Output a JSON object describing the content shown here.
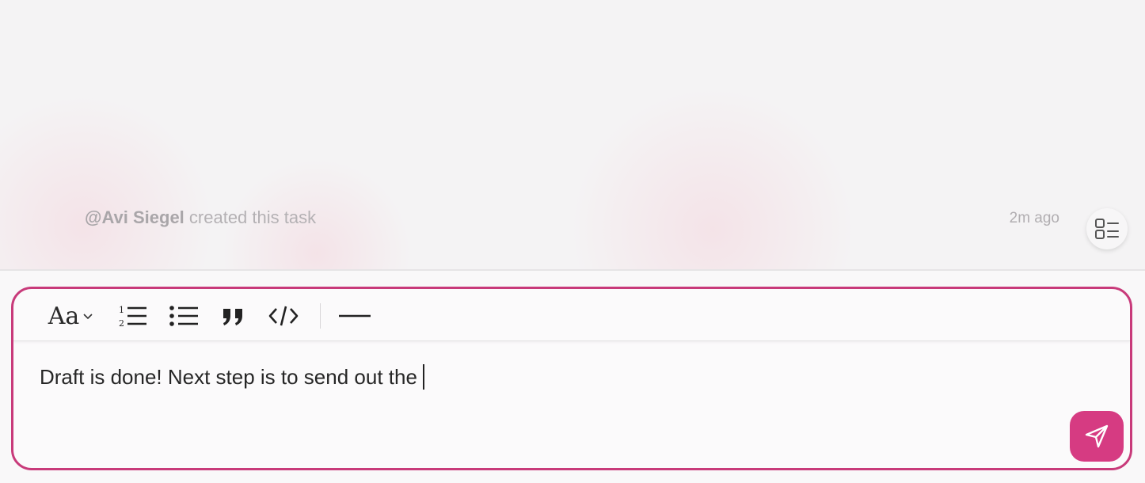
{
  "activity": {
    "mention": "@Avi Siegel",
    "action": " created this task",
    "time": "2m ago"
  },
  "toolbar": {
    "font_label": "Aa",
    "icons": [
      "chevron-down-icon",
      "numbered-list-icon",
      "bullet-list-icon",
      "quote-icon",
      "code-icon",
      "horizontal-rule-icon"
    ]
  },
  "editor": {
    "value": "Draft is done! Next step is to send out the"
  },
  "colors": {
    "accent": "#d63b82",
    "border": "#c83a7a"
  }
}
